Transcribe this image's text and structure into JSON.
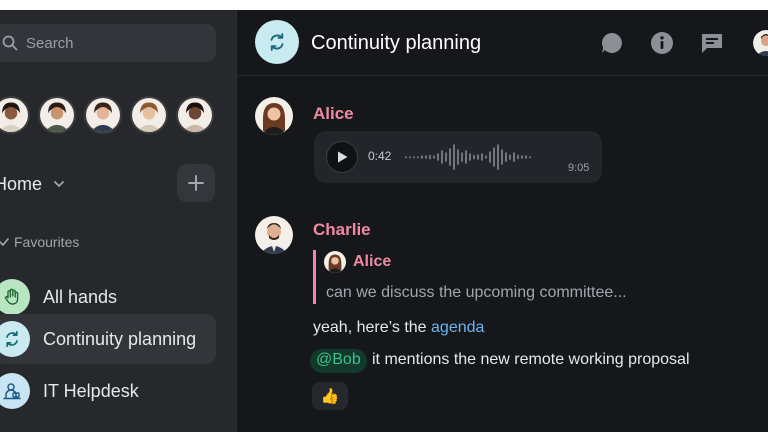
{
  "search": {
    "placeholder": "Search"
  },
  "people": [
    {
      "name": "person-1",
      "skin": "#8a5a3c",
      "hair": "#1f1612",
      "shirt": "#d9d2c4"
    },
    {
      "name": "person-2",
      "skin": "#c8946c",
      "hair": "#2b1b12",
      "shirt": "#4d5a4a"
    },
    {
      "name": "person-3",
      "skin": "#e3b49a",
      "hair": "#3a2418",
      "shirt": "#2e3a4f"
    },
    {
      "name": "person-4",
      "skin": "#e8bf9e",
      "hair": "#8c5a2e",
      "shirt": "#d8c9b5"
    },
    {
      "name": "person-5",
      "skin": "#6d4530",
      "hair": "#1b120e",
      "shirt": "#c9b8a3"
    }
  ],
  "space": {
    "label": "Home"
  },
  "favourites": {
    "label": "Favourites"
  },
  "rooms": [
    {
      "label": "All hands",
      "icon": "raised-hand-icon",
      "bg": "#b9e6c2",
      "active": false
    },
    {
      "label": "Continuity planning",
      "icon": "sync-arrows-icon",
      "bg": "#c9eaf0",
      "active": true
    },
    {
      "label": "IT Helpdesk",
      "icon": "helpdesk-icon",
      "bg": "#c9e4f3",
      "active": false
    }
  ],
  "header": {
    "title": "Continuity planning"
  },
  "messages": {
    "first": {
      "sender": "Alice",
      "voice": {
        "position": "0:42",
        "duration": "9:05"
      }
    },
    "second": {
      "sender": "Charlie",
      "reply": {
        "sender": "Alice",
        "text": "can we discuss the upcoming committee..."
      },
      "line1_prefix": "yeah, here’s the ",
      "line1_link": "agenda",
      "mention": "@Bob",
      "line2": "it mentions the new remote working proposal",
      "reaction": "👍"
    }
  },
  "colors": {
    "sender": "#f08aa2",
    "link": "#6eb3ee",
    "mention": "#39c38b",
    "sidebar": "#26282c",
    "main": "#15171b"
  }
}
